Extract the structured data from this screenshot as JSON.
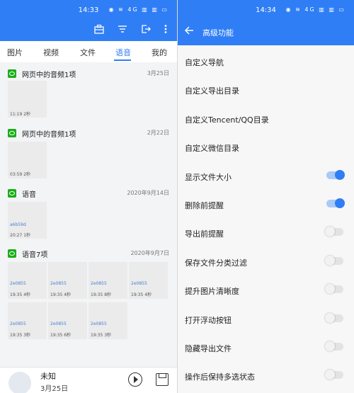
{
  "left": {
    "status": {
      "time": "14:33",
      "icons": "◉ ≋ 4G ▥ ▥ ▭"
    },
    "tabs": [
      "图片",
      "视频",
      "文件",
      "语音",
      "我的"
    ],
    "active_tab": "语音",
    "groups": [
      {
        "title": "网页中的音频1项",
        "date": "3月25日",
        "tiles": [
          {
            "name": "",
            "info": "11:19  2秒"
          }
        ]
      },
      {
        "title": "网页中的音频1项",
        "date": "2月22日",
        "tiles": [
          {
            "name": "",
            "info": "03:59  2秒"
          }
        ]
      },
      {
        "title": "语音",
        "date": "2020年9月14日",
        "tiles": [
          {
            "name": "a6b59d",
            "info": "20:27  1秒"
          }
        ]
      },
      {
        "title": "语音7项",
        "date": "2020年9月7日",
        "tiles": [
          {
            "name": "2e0855",
            "info": "19:35  4秒"
          },
          {
            "name": "2e0855",
            "info": "19:35  4秒"
          },
          {
            "name": "2e0855",
            "info": "19:35  8秒"
          },
          {
            "name": "2e0855",
            "info": "19:35  4秒"
          },
          {
            "name": "2e0855",
            "info": "19:35  3秒"
          },
          {
            "name": "2e0855",
            "info": "19:35  6秒"
          },
          {
            "name": "2e0855",
            "info": "19:35  3秒"
          }
        ]
      }
    ],
    "bottom": {
      "title": "未知",
      "subtitle": "3月25日"
    }
  },
  "right": {
    "status": {
      "time": "14:34",
      "icons": "◉ ≋ 4G ▥ ▥ ▭"
    },
    "title": "高级功能",
    "rows": [
      {
        "label": "自定义导航"
      },
      {
        "label": "自定义导出目录"
      },
      {
        "label": "自定义Tencent/QQ目录"
      },
      {
        "label": "自定义微信目录"
      },
      {
        "label": "显示文件大小",
        "toggle": true
      },
      {
        "label": "删除前提醒",
        "toggle": true
      },
      {
        "label": "导出前提醒",
        "toggle": false
      },
      {
        "label": "保存文件分类过滤",
        "toggle": false
      },
      {
        "label": "提升图片清晰度",
        "toggle": false
      },
      {
        "label": "打开浮动按钮",
        "toggle": false
      },
      {
        "label": "隐藏导出文件",
        "toggle": false
      },
      {
        "label": "操作后保持多选状态",
        "toggle": false
      }
    ]
  },
  "colors": {
    "accent": "#2f7ef5",
    "wechat": "#1aad19"
  }
}
